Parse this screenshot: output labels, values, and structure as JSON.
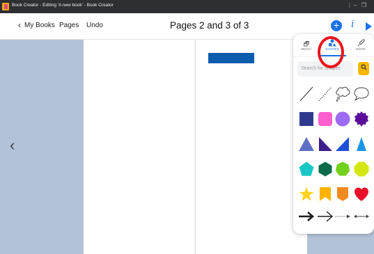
{
  "window": {
    "title": "Book Creator - Editing 'A new book' - Book Creator",
    "controls": [
      "⋮",
      "–",
      "❐"
    ]
  },
  "toolbar": {
    "back_label": "My Books",
    "pages_label": "Pages",
    "undo_label": "Undo",
    "page_indicator": "Pages 2 and 3 of 3",
    "add_label": "+",
    "info_label": "i"
  },
  "panel": {
    "tabs": [
      {
        "label": "MEDIA",
        "icon": "media-icon"
      },
      {
        "label": "SHAPES",
        "icon": "shapes-icon",
        "active": true
      },
      {
        "label": "MORE",
        "icon": "rocket-icon"
      }
    ],
    "search_placeholder": "Search for shapes",
    "shapes": [
      [
        "line",
        "dashed-line",
        "thought-bubble",
        "speech-bubble"
      ],
      [
        "square",
        "rounded-square",
        "circle",
        "badge"
      ],
      [
        "triangle",
        "right-triangle-left",
        "right-triangle-right",
        "triangle-narrow"
      ],
      [
        "pentagon",
        "hexagon",
        "heptagon",
        "octagon"
      ],
      [
        "star",
        "bookmark",
        "ribbon",
        "heart"
      ],
      [
        "arrow-thick",
        "arrow-thin",
        "arrow-dotted",
        "arrow-double"
      ]
    ],
    "colors": {
      "navy": "#2f3a8f",
      "pink": "#ff5fcf",
      "purple": "#9b6bf2",
      "deep_purple": "#5b0f99",
      "slate_blue": "#5f6fc8",
      "indigo": "#3b1e8c",
      "blue": "#1e4fd8",
      "sky": "#1a94e8",
      "turquoise": "#1bc6c6",
      "dark_green": "#0c6b4a",
      "green": "#72d11b",
      "lime": "#d4e80f",
      "yellow": "#ffd21e",
      "amber": "#ffb300",
      "orange": "#f58a1f",
      "red": "#e8102a",
      "highlight": "#e8141c"
    }
  }
}
